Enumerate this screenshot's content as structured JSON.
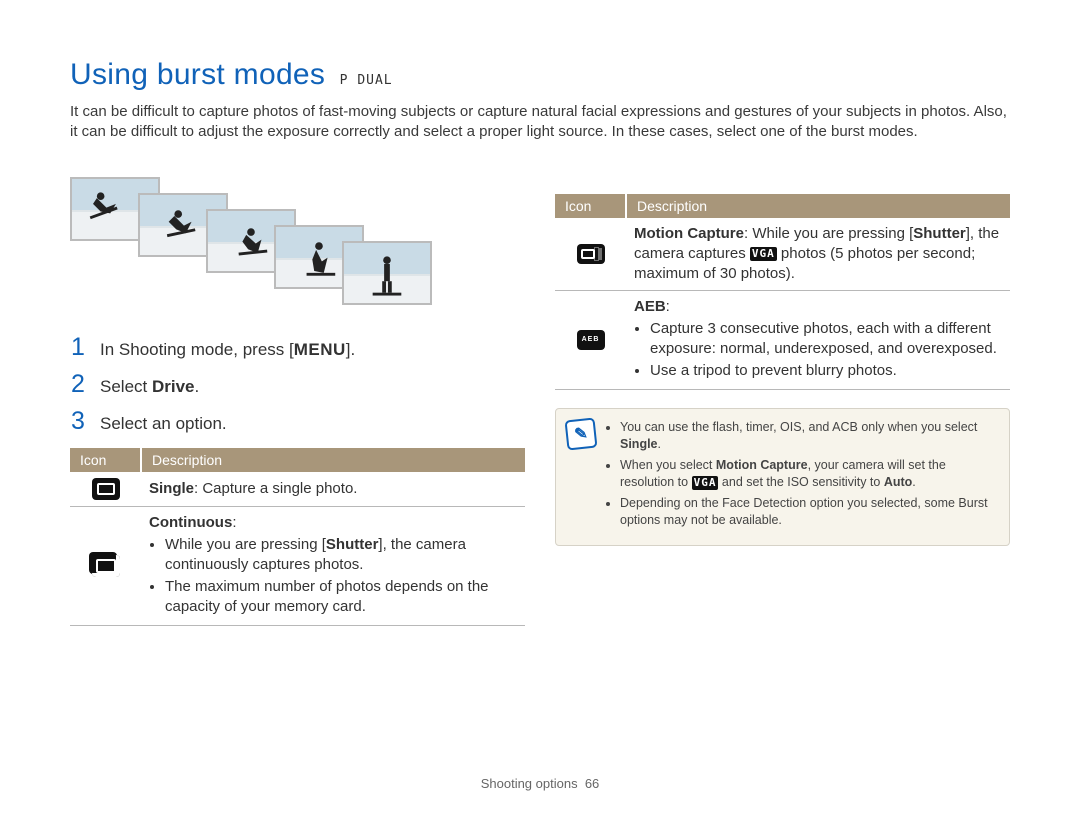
{
  "header": {
    "title": "Using burst modes",
    "mode_indicator": "P  DUAL"
  },
  "intro": "It can be difficult to capture photos of fast-moving subjects or capture natural facial expressions and gestures of your subjects in photos. Also, it can be difficult to adjust the exposure correctly and select a proper light source. In these cases, select one of the burst modes.",
  "steps": {
    "s1_a": "In Shooting mode, press [",
    "s1_menu": "MENU",
    "s1_b": "].",
    "s2_a": "Select ",
    "s2_bold": "Drive",
    "s2_b": ".",
    "s3": "Select an option."
  },
  "table_headers": {
    "icon": "Icon",
    "desc": "Description"
  },
  "left_table": {
    "single_bold": "Single",
    "single_rest": ": Capture a single photo.",
    "continuous_label": "Continuous",
    "continuous_b1_a": "While you are pressing [",
    "continuous_b1_shutter": "Shutter",
    "continuous_b1_b": "], the camera continuously captures photos.",
    "continuous_b2": "The maximum number of photos depends on the capacity of your memory card."
  },
  "right_table": {
    "motion_bold": "Motion Capture",
    "motion_a": ": While you are pressing [",
    "motion_shutter": "Shutter",
    "motion_b": "], the camera captures ",
    "motion_vga": "VGA",
    "motion_c": " photos (5 photos per second; maximum of 30 photos).",
    "aeb_label": "AEB",
    "aeb_colon": ":",
    "aeb_b1": "Capture 3 consecutive photos, each with a different exposure: normal, underexposed, and overexposed.",
    "aeb_b2": "Use a tripod to prevent blurry photos."
  },
  "note": {
    "n1_a": "You can use the flash, timer, OIS, and ACB only when you select ",
    "n1_bold": "Single",
    "n1_b": ".",
    "n2_a": "When you select ",
    "n2_bold": "Motion Capture",
    "n2_b": ", your camera will set the resolution to ",
    "n2_vga": "VGA",
    "n2_c": " and set the ISO sensitivity to ",
    "n2_bold2": "Auto",
    "n2_d": ".",
    "n3": "Depending on the Face Detection option you selected, some Burst options may not be available."
  },
  "footer": {
    "section": "Shooting options",
    "page": "66"
  }
}
